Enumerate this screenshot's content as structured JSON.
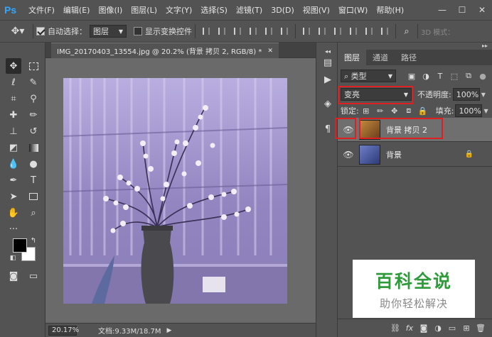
{
  "app": {
    "logo": "Ps"
  },
  "menu": [
    "文件(F)",
    "编辑(E)",
    "图像(I)",
    "图层(L)",
    "文字(Y)",
    "选择(S)",
    "滤镜(T)",
    "3D(D)",
    "视图(V)",
    "窗口(W)",
    "帮助(H)"
  ],
  "window_controls": {
    "minimize": "—",
    "maximize": "☐",
    "close": "✕"
  },
  "options": {
    "auto_select_label": "自动选择：",
    "auto_select_checked": true,
    "auto_select_target": "图层",
    "show_transform_label": "显示变换控件",
    "show_transform_checked": false,
    "mode_3d_label": "3D 模式："
  },
  "document": {
    "tab_title": "IMG_20170403_13554.jpg @ 20.2% (背景 拷贝 2, RGB/8) *",
    "tab_close": "✕",
    "zoom": "20.17%",
    "doc_info": "文档:9.33M/18.7M"
  },
  "colors": {
    "foreground": "#000000",
    "background": "#ffffff",
    "highlight": "#e02020"
  },
  "layers_panel": {
    "tabs": [
      "图层",
      "通道",
      "路径"
    ],
    "filter_kind": "类型",
    "blend_mode": "变亮",
    "opacity_label": "不透明度:",
    "opacity_value": "100%",
    "lock_label": "锁定:",
    "fill_label": "填充:",
    "fill_value": "100%",
    "layers": [
      {
        "name": "背景 拷贝 2",
        "visible": true,
        "selected": true,
        "locked": false
      },
      {
        "name": "背景",
        "visible": true,
        "selected": false,
        "locked": true
      }
    ],
    "footer_icons": [
      "link-icon",
      "fx-icon",
      "mask-icon",
      "adjustment-icon",
      "group-icon",
      "new-layer-icon",
      "trash-icon"
    ]
  },
  "watermark": {
    "title": "百科全说",
    "subtitle": "助你轻松解决"
  }
}
